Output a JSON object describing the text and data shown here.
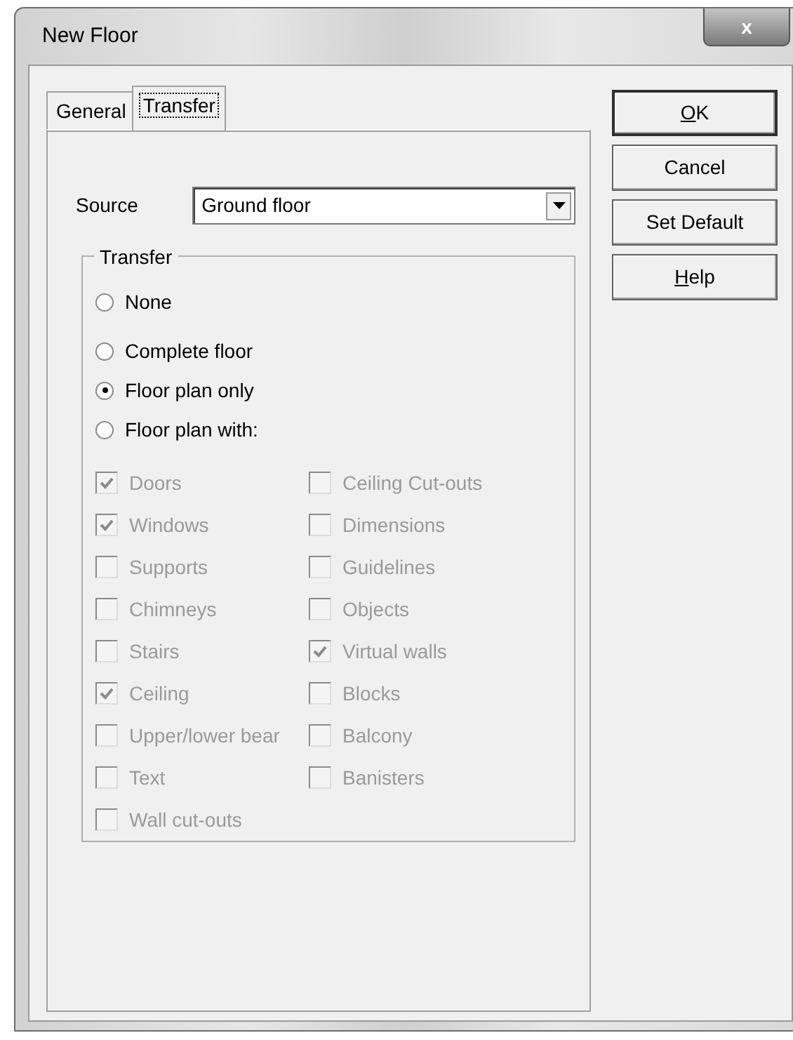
{
  "window": {
    "title": "New Floor",
    "close_label": "x"
  },
  "tabs": [
    {
      "label": "General",
      "selected": false
    },
    {
      "label": "Transfer",
      "selected": true
    }
  ],
  "source": {
    "label": "Source",
    "value": "Ground floor"
  },
  "transfer": {
    "title": "Transfer",
    "radios": [
      {
        "label": "None",
        "selected": false
      },
      {
        "label": "Complete floor",
        "selected": false
      },
      {
        "label": "Floor plan only",
        "selected": true
      },
      {
        "label": "Floor plan with:",
        "selected": false
      }
    ],
    "options_left": [
      {
        "label": "Doors",
        "checked": true,
        "disabled": true
      },
      {
        "label": "Windows",
        "checked": true,
        "disabled": true
      },
      {
        "label": "Supports",
        "checked": false,
        "disabled": true
      },
      {
        "label": "Chimneys",
        "checked": false,
        "disabled": true
      },
      {
        "label": "Stairs",
        "checked": false,
        "disabled": true
      },
      {
        "label": "Ceiling",
        "checked": true,
        "disabled": true
      },
      {
        "label": "Upper/lower bear",
        "checked": false,
        "disabled": true
      },
      {
        "label": "Text",
        "checked": false,
        "disabled": true
      },
      {
        "label": "Wall cut-outs",
        "checked": false,
        "disabled": true
      }
    ],
    "options_right": [
      {
        "label": "Ceiling Cut-outs",
        "checked": false,
        "disabled": true
      },
      {
        "label": "Dimensions",
        "checked": false,
        "disabled": true
      },
      {
        "label": "Guidelines",
        "checked": false,
        "disabled": true
      },
      {
        "label": "Objects",
        "checked": false,
        "disabled": true
      },
      {
        "label": "Virtual walls",
        "checked": true,
        "disabled": true
      },
      {
        "label": "Blocks",
        "checked": false,
        "disabled": true
      },
      {
        "label": "Balcony",
        "checked": false,
        "disabled": true
      },
      {
        "label": "Banisters",
        "checked": false,
        "disabled": true
      }
    ]
  },
  "buttons": [
    {
      "label": "OK",
      "access_key_underlined": true
    },
    {
      "label": "Cancel",
      "access_key_underlined": false
    },
    {
      "label": "Set Default",
      "access_key_underlined": false
    },
    {
      "label": "Help",
      "access_key_underlined": true
    }
  ]
}
